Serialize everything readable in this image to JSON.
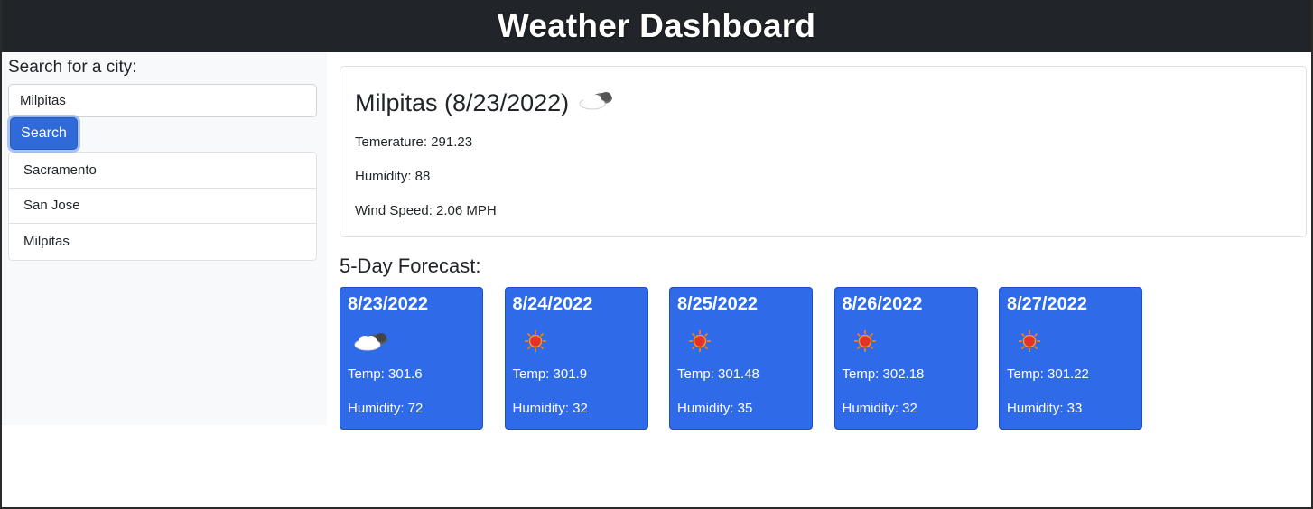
{
  "header": {
    "title": "Weather Dashboard"
  },
  "sidebar": {
    "search_label": "Search for a city:",
    "search_value": "Milpitas",
    "search_button": "Search",
    "history": [
      "Sacramento",
      "San Jose",
      "Milpitas"
    ]
  },
  "current": {
    "title": "Milpitas (8/23/2022)",
    "icon": "cloud-icon",
    "temperature": "Temerature: 291.23",
    "humidity": "Humidity: 88",
    "wind": "Wind Speed: 2.06 MPH"
  },
  "forecast": {
    "title": "5-Day Forecast:",
    "days": [
      {
        "date": "8/23/2022",
        "icon": "cloud-icon",
        "temp": "Temp: 301.6",
        "humidity": "Humidity: 72"
      },
      {
        "date": "8/24/2022",
        "icon": "sun-icon",
        "temp": "Temp: 301.9",
        "humidity": "Humidity: 32"
      },
      {
        "date": "8/25/2022",
        "icon": "sun-icon",
        "temp": "Temp: 301.48",
        "humidity": "Humidity: 35"
      },
      {
        "date": "8/26/2022",
        "icon": "sun-icon",
        "temp": "Temp: 302.18",
        "humidity": "Humidity: 32"
      },
      {
        "date": "8/27/2022",
        "icon": "sun-icon",
        "temp": "Temp: 301.22",
        "humidity": "Humidity: 33"
      }
    ]
  },
  "colors": {
    "header_bg": "#212529",
    "accent": "#2f6ad8",
    "forecast_card": "#2f6ae8",
    "sidebar_bg": "#f8f9fa"
  }
}
